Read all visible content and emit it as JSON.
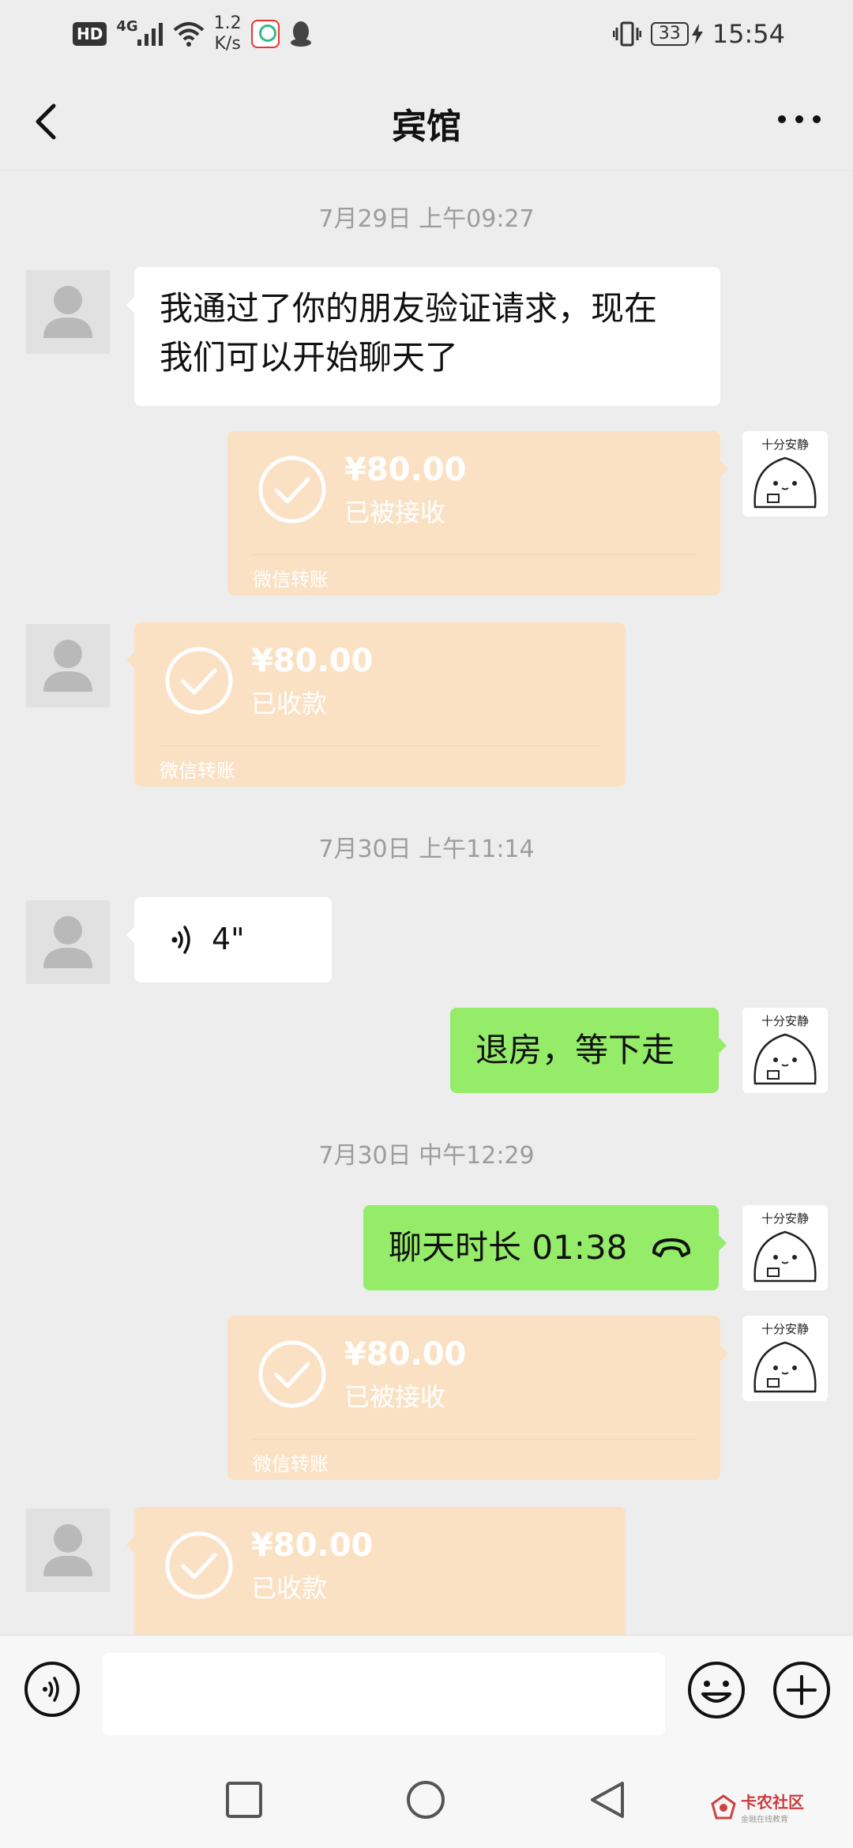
{
  "status_bar": {
    "left_badge": "HD",
    "network": "4G",
    "speed_value": "1.2",
    "speed_unit": "K/s",
    "battery": "33",
    "time": "15:54"
  },
  "header": {
    "title": "宾馆"
  },
  "avatar": {
    "self_caption": "十分安静"
  },
  "messages": [
    {
      "type": "timestamp",
      "text": "7月29日 上午09:27"
    },
    {
      "type": "text",
      "from": "contact",
      "text_line1": "我通过了你的朋友验证请求，现在",
      "text_line2": "我们可以开始聊天了"
    },
    {
      "type": "transfer",
      "from": "self",
      "amount": "¥80.00",
      "status": "已被接收",
      "footer": "微信转账"
    },
    {
      "type": "transfer",
      "from": "contact",
      "amount": "¥80.00",
      "status": "已收款",
      "footer": "微信转账"
    },
    {
      "type": "timestamp",
      "text": "7月30日 上午11:14"
    },
    {
      "type": "voice",
      "from": "contact",
      "duration": "4\""
    },
    {
      "type": "text",
      "from": "self",
      "text": "退房，等下走"
    },
    {
      "type": "timestamp",
      "text": "7月30日 中午12:29"
    },
    {
      "type": "call",
      "from": "self",
      "text": "聊天时长 01:38"
    },
    {
      "type": "transfer",
      "from": "self",
      "amount": "¥80.00",
      "status": "已被接收",
      "footer": "微信转账"
    },
    {
      "type": "transfer",
      "from": "contact",
      "amount": "¥80.00",
      "status": "已收款",
      "footer": ""
    }
  ],
  "watermark": {
    "name": "卡农社区",
    "slogan": "金融在线教育"
  },
  "colors": {
    "background": "#ededed",
    "green_bubble": "#95ec69",
    "transfer_bubble": "#fbe1c4"
  }
}
